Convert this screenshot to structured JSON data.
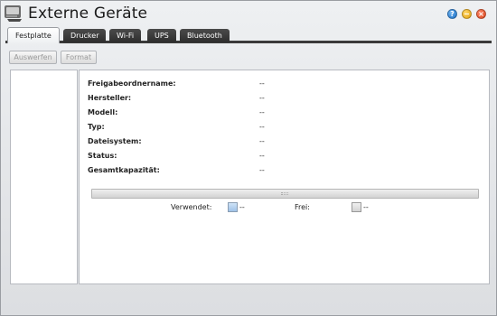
{
  "window": {
    "title": "Externe Geräte",
    "buttons": {
      "help": "?",
      "minimize_icon": "minimize-icon",
      "close_icon": "close-icon"
    }
  },
  "tabs": [
    {
      "label": "Festplatte",
      "active": true
    },
    {
      "label": "Drucker",
      "active": false
    },
    {
      "label": "Wi-Fi",
      "active": false
    },
    {
      "label": "UPS",
      "active": false
    },
    {
      "label": "Bluetooth",
      "active": false
    }
  ],
  "toolbar": {
    "eject_label": "Auswerfen",
    "format_label": "Format",
    "enabled": false
  },
  "details": [
    {
      "label": "Freigabeordnername:",
      "value": "--"
    },
    {
      "label": "Hersteller:",
      "value": "--"
    },
    {
      "label": "Modell:",
      "value": "--"
    },
    {
      "label": "Typ:",
      "value": "--"
    },
    {
      "label": "Dateisystem:",
      "value": "--"
    },
    {
      "label": "Status:",
      "value": "--"
    },
    {
      "label": "Gesamtkapazität:",
      "value": "--"
    }
  ],
  "usage": {
    "used_label": "Verwendet:",
    "used_value": "--",
    "free_label": "Frei:",
    "free_value": "--",
    "used_fraction": 0
  },
  "colors": {
    "tab_bar": "#3a3a3a",
    "used_swatch": "#9fc2e8",
    "free_swatch": "#d3d3d3"
  }
}
